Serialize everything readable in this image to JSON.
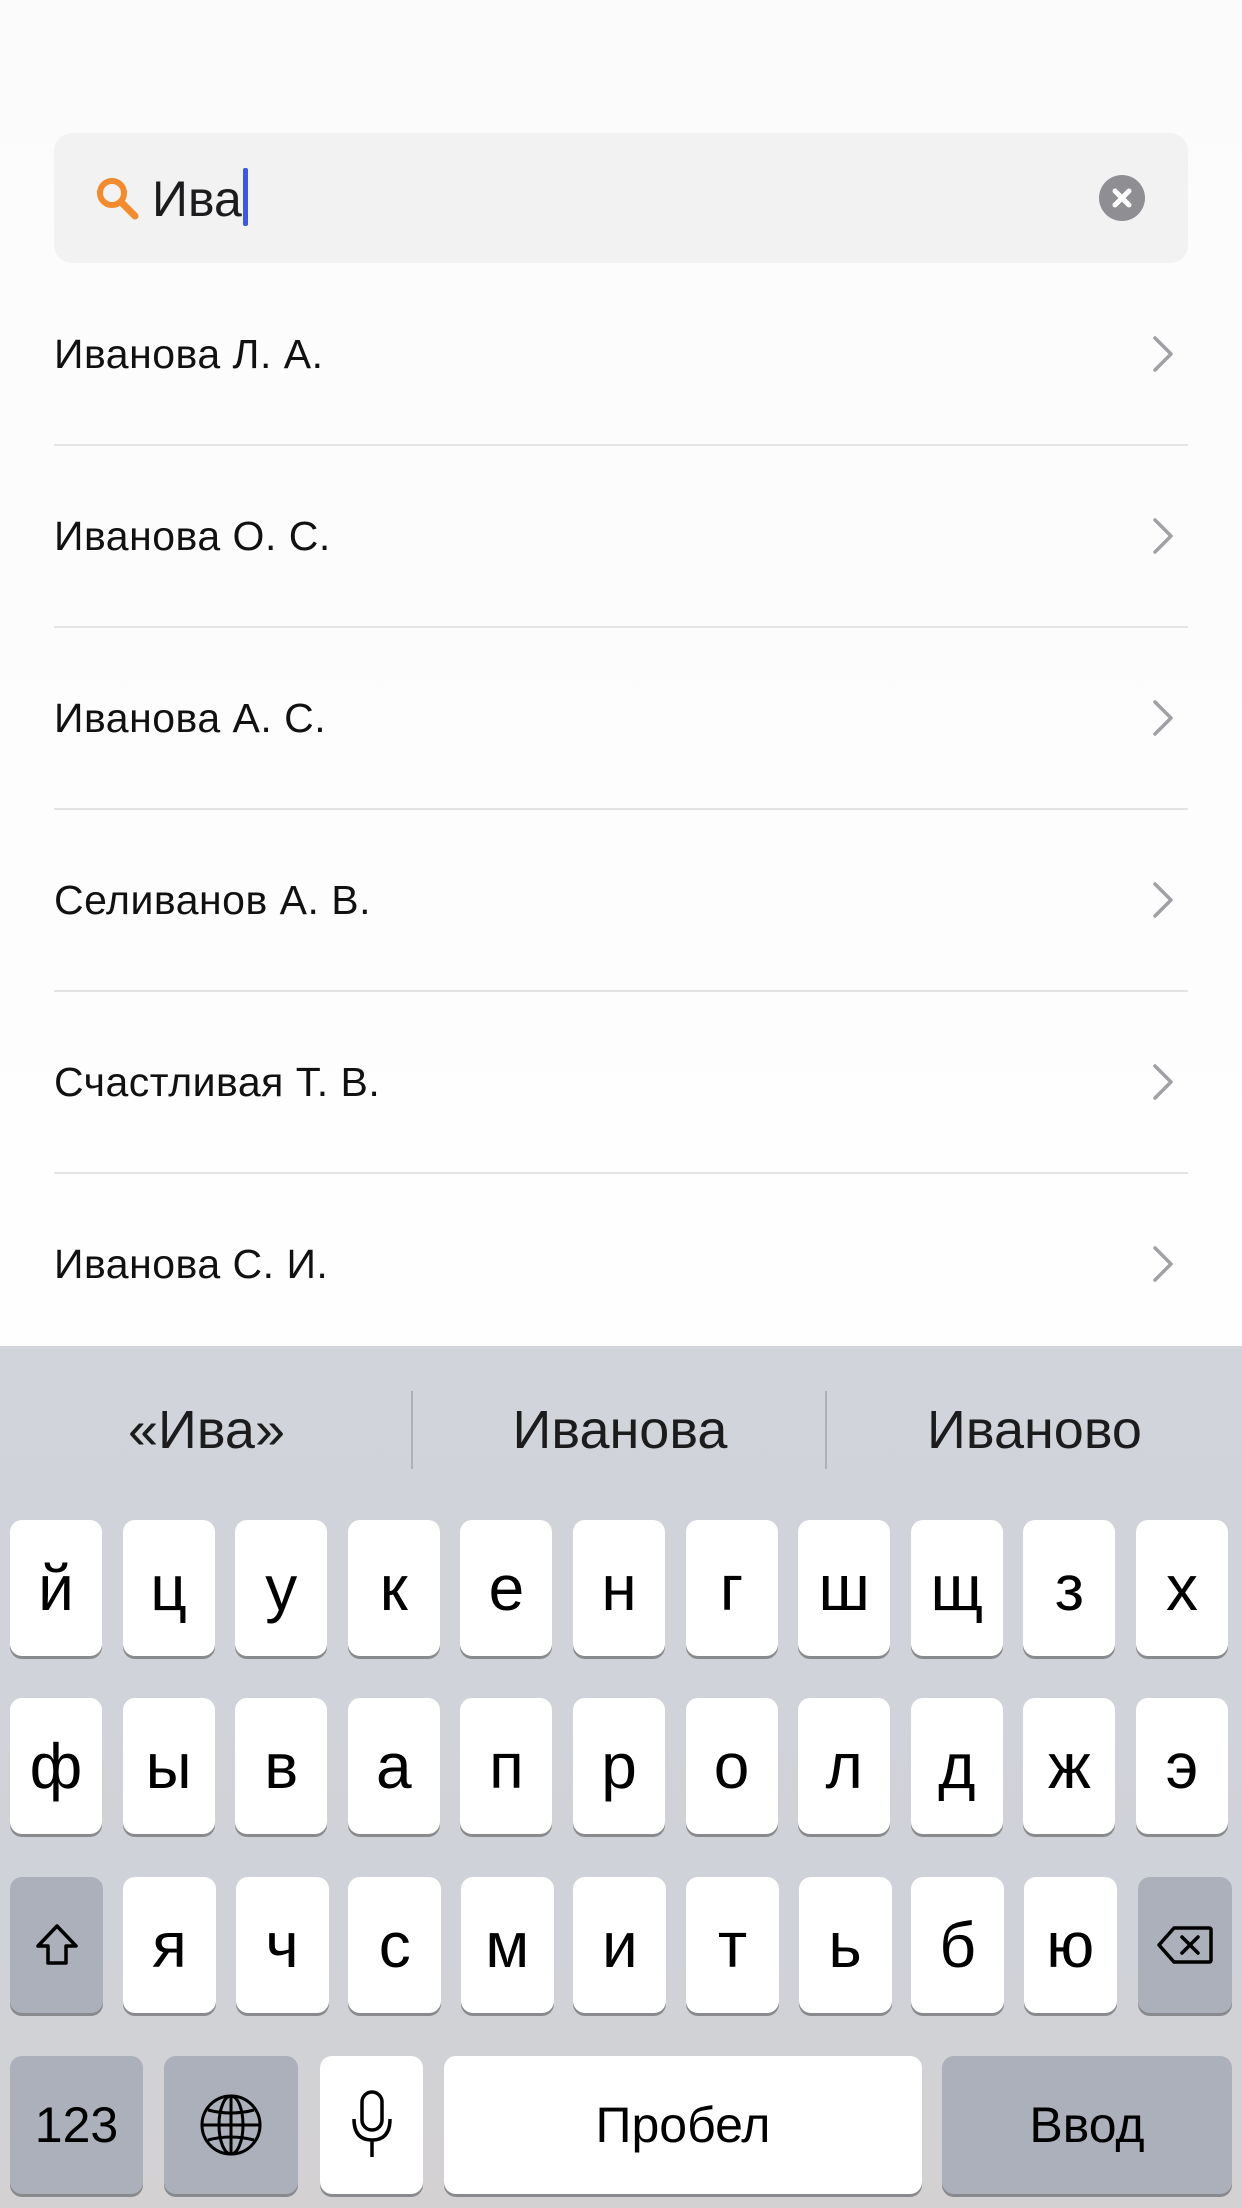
{
  "search": {
    "query": "Ива",
    "colors": {
      "icon": "#f28a2e",
      "caret": "#3b5bdb",
      "clear": "#8e8e93"
    }
  },
  "results": [
    {
      "name": "Иванова Л. А."
    },
    {
      "name": "Иванова О. С."
    },
    {
      "name": "Иванова А. С."
    },
    {
      "name": "Селиванов А. В."
    },
    {
      "name": "Счастливая Т. В."
    },
    {
      "name": "Иванова С. И."
    }
  ],
  "keyboard": {
    "suggestions": [
      "«Ива»",
      "Иванова",
      "Иваново"
    ],
    "row1": [
      "й",
      "ц",
      "у",
      "к",
      "е",
      "н",
      "г",
      "ш",
      "щ",
      "з",
      "х"
    ],
    "row2": [
      "ф",
      "ы",
      "в",
      "а",
      "п",
      "р",
      "о",
      "л",
      "д",
      "ж",
      "э"
    ],
    "row3": [
      "я",
      "ч",
      "с",
      "м",
      "и",
      "т",
      "ь",
      "б",
      "ю"
    ],
    "numbers_label": "123",
    "space_label": "Пробел",
    "return_label": "Ввод",
    "icons": [
      "shift-icon",
      "backspace-icon",
      "globe-icon",
      "microphone-icon"
    ]
  }
}
